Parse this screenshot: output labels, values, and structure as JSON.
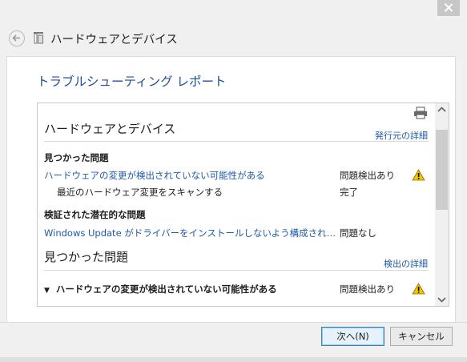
{
  "window": {
    "title": "ハードウェアとデバイス"
  },
  "report": {
    "heading": "トラブルシューティング レポート",
    "section1": {
      "title": "ハードウェアとデバイス",
      "detail_link": "発行元の詳細",
      "found_header": "見つかった問題",
      "issue_link": "ハードウェアの変更が検出されていない可能性がある",
      "issue_status": "問題検出あり",
      "sub_item": "最近のハードウェア変更をスキャンする",
      "sub_status": "完了",
      "potential_header": "検証された潜在的な問題",
      "potential_link": "Windows Update がドライバーをインストールしないよう構成され…",
      "potential_status": "問題なし"
    },
    "section2": {
      "title": "見つかった問題",
      "detail_link": "検出の詳細",
      "expander_label": "ハードウェアの変更が検出されていない可能性がある",
      "expander_status": "問題検出あり"
    }
  },
  "buttons": {
    "next": "次へ(N)",
    "cancel": "キャンセル"
  },
  "icons": {
    "back": "back-arrow-icon",
    "print": "printer-icon",
    "warning": "warning-icon"
  },
  "colors": {
    "link": "#1e5aa8",
    "heading": "#1e4e9a",
    "warning": "#f2c500"
  }
}
